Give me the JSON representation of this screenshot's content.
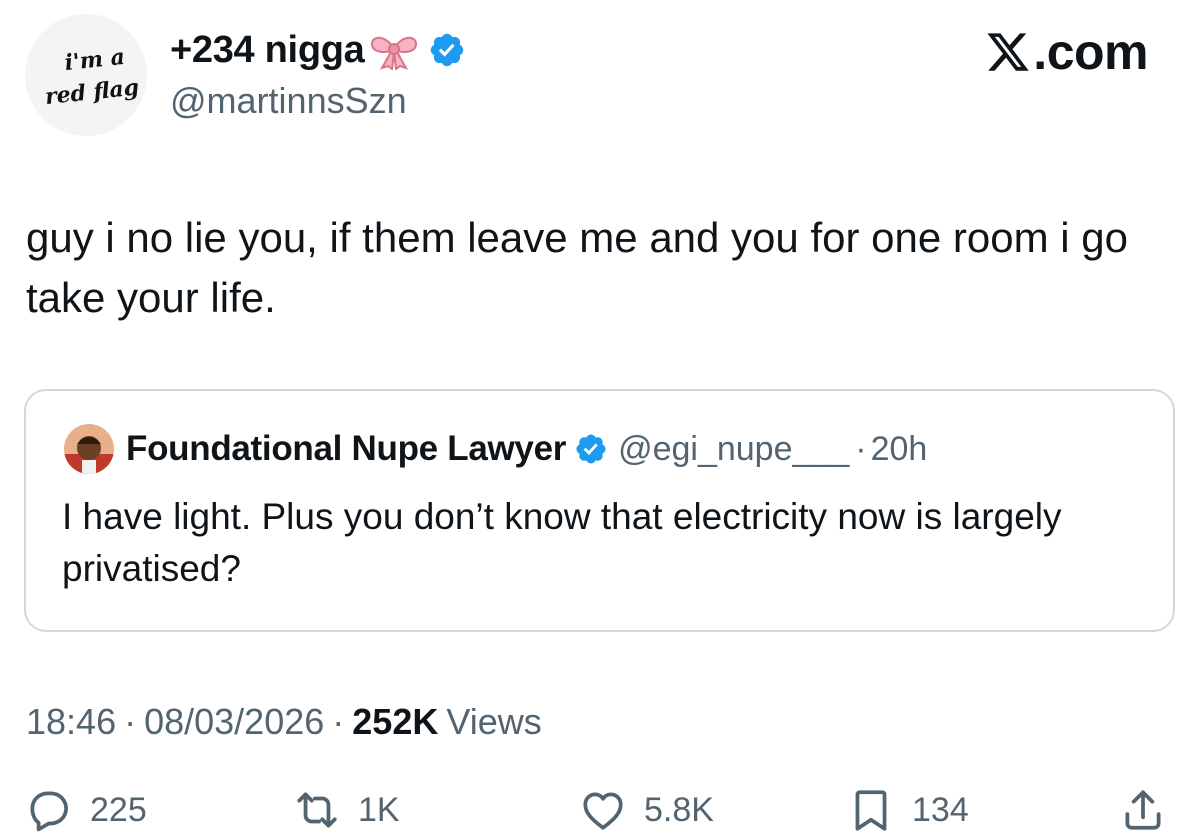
{
  "author": {
    "display_name": "+234 nigga",
    "handle": "@martinnsSzn",
    "avatar_text": [
      "i'm a",
      "red flag"
    ],
    "bow_icon": "ribbon-bow-icon",
    "verified_icon": "verified-badge-icon",
    "verified_color": "#1d9bf0"
  },
  "branding": {
    "site": ".com",
    "logo_icon": "x-logo-icon"
  },
  "tweet": {
    "text": "guy i no lie you, if them leave me and you for one room i go take your life."
  },
  "quoted_tweet": {
    "display_name": "Foundational Nupe Lawyer",
    "handle": "@egi_nupe___",
    "separator": "·",
    "time": "20h",
    "text": "I have light. Plus you don’t know that electricity now is largely privatised?"
  },
  "meta": {
    "time": "18:46",
    "sep1": "·",
    "date": "08/03/2026",
    "sep2": "·",
    "views_count": "252K",
    "views_label": "Views"
  },
  "actions": {
    "replies": "225",
    "reposts": "1K",
    "likes": "5.8K",
    "bookmarks": "134"
  },
  "colors": {
    "text": "#0f1419",
    "secondary": "#536471",
    "border": "#cfd9de",
    "verified": "#1d9bf0"
  }
}
